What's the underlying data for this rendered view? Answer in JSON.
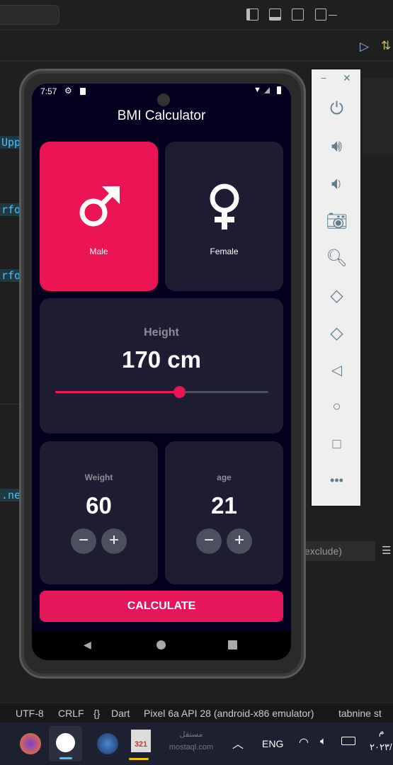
{
  "ide": {
    "code_snippets": [
      "Upp",
      "rfor",
      "rfor",
      ".ner"
    ],
    "search_filter": "exclude)",
    "status": {
      "encoding": "UTF-8",
      "line_ending": "CRLF",
      "language": "Dart",
      "device": "Pixel 6a API 28 (android-x86 emulator)",
      "extension": "tabnine st"
    }
  },
  "taskbar": {
    "watermark": "مستقل mostaql.com",
    "lang": "ENG",
    "clock_time": "م",
    "clock_date": "٢٠٢٣/"
  },
  "phone": {
    "status_time": "7:57",
    "app_title": "BMI Calculator",
    "gender": {
      "male_label": "Male",
      "female_label": "Female",
      "selected": "Male"
    },
    "height": {
      "label": "Height",
      "value": "170",
      "unit": "cm",
      "display": "170 cm",
      "slider_fraction": 0.58
    },
    "weight": {
      "label": "Weight",
      "value": "60"
    },
    "age": {
      "label": "age",
      "value": "21"
    },
    "calculate_label": "CALCULATE",
    "colors": {
      "accent": "#eb1555",
      "card": "#1d1c33",
      "background": "#03001f",
      "round_button": "#4c4f5e"
    }
  },
  "emulator_controls": [
    "power",
    "volume-up",
    "volume-down",
    "screenshot",
    "zoom",
    "rotate-left",
    "rotate-right",
    "back",
    "home",
    "overview",
    "more"
  ]
}
